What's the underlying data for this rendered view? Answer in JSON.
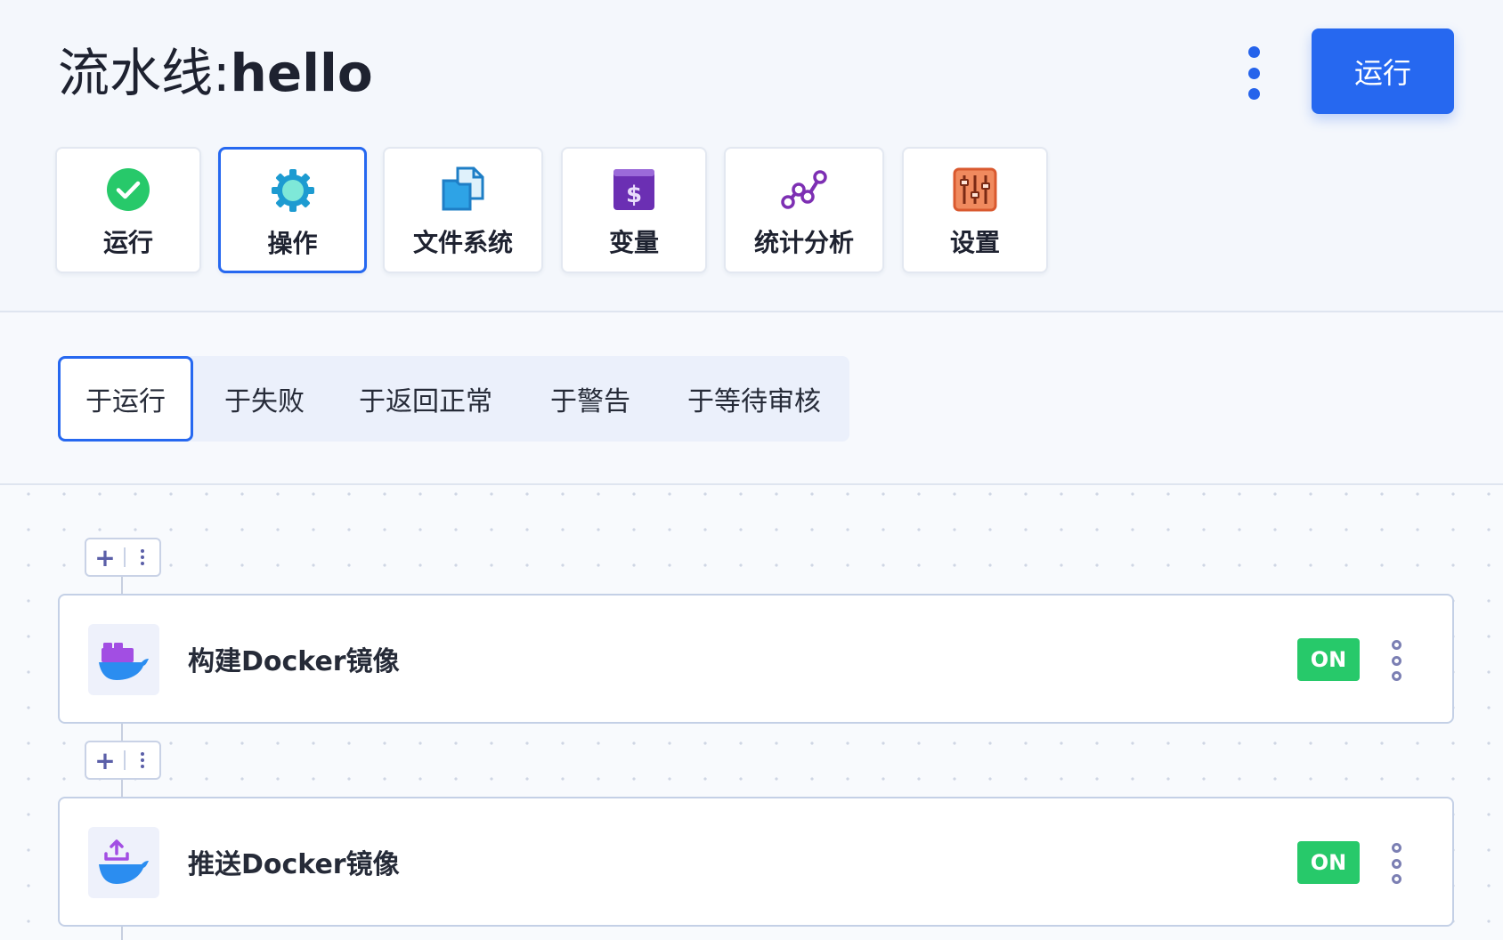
{
  "header": {
    "title_prefix": "流水线:",
    "title_name": "hello",
    "run_button": "运行"
  },
  "nav": [
    {
      "label": "运行",
      "icon": "check-circle-icon"
    },
    {
      "label": "操作",
      "icon": "gear-icon"
    },
    {
      "label": "文件系统",
      "icon": "files-icon"
    },
    {
      "label": "变量",
      "icon": "dollar-icon"
    },
    {
      "label": "统计分析",
      "icon": "stats-icon"
    },
    {
      "label": "设置",
      "icon": "sliders-icon"
    }
  ],
  "nav_active": "操作",
  "tabs": [
    "于运行",
    "于失败",
    "于返回正常",
    "于警告",
    "于等待审核"
  ],
  "tabs_active": "于运行",
  "steps": [
    {
      "name": "构建Docker镜像",
      "toggle": "ON",
      "icon": "docker-build-icon"
    },
    {
      "name": "推送Docker镜像",
      "toggle": "ON",
      "icon": "docker-push-icon"
    }
  ],
  "colors": {
    "accent": "#2668f0",
    "toggle_on": "#27c96a"
  }
}
